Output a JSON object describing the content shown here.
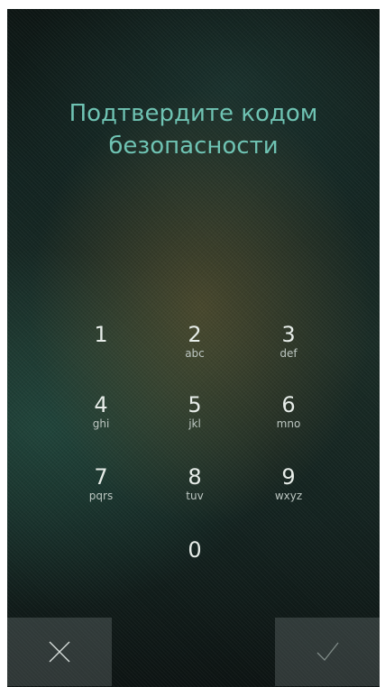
{
  "title": {
    "line1": "Подтвердите кодом",
    "line2": "безопасности"
  },
  "keypad": {
    "keys": [
      {
        "digit": "1",
        "letters": ""
      },
      {
        "digit": "2",
        "letters": "abc"
      },
      {
        "digit": "3",
        "letters": "def"
      },
      {
        "digit": "4",
        "letters": "ghi"
      },
      {
        "digit": "5",
        "letters": "jkl"
      },
      {
        "digit": "6",
        "letters": "mno"
      },
      {
        "digit": "7",
        "letters": "pqrs"
      },
      {
        "digit": "8",
        "letters": "tuv"
      },
      {
        "digit": "9",
        "letters": "wxyz"
      },
      {
        "digit": "0",
        "letters": ""
      }
    ]
  },
  "actions": {
    "cancel_icon": "close-icon",
    "confirm_icon": "check-icon"
  },
  "colors": {
    "title": "#6fc3b3",
    "digit": "#e6ece8",
    "letters": "#bcc6c1",
    "action_bg": "#5a6262"
  }
}
